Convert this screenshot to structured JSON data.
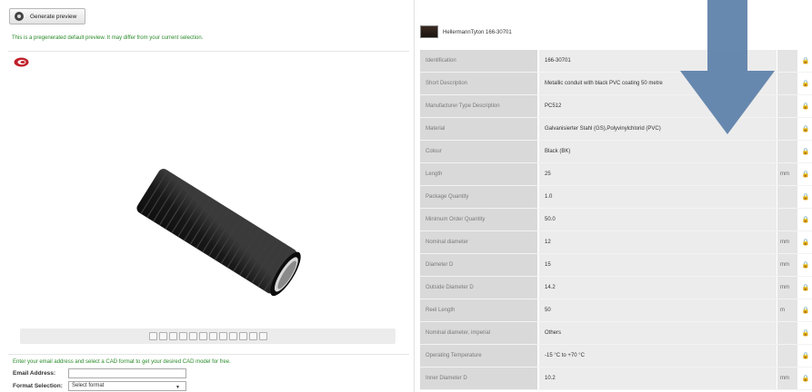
{
  "left": {
    "generate_button": "Generate preview",
    "note": "This is a pregenerated default preview. It may differ from your current selection.",
    "email_info": "Enter your email address and select a CAD format to get your desired CAD model for free.",
    "email_label": "Email Address:",
    "format_label": "Format Selection:",
    "format_value": "Select format"
  },
  "product": {
    "title": "HellermannTyton 166-30701"
  },
  "rows": [
    {
      "label": "Identification",
      "value": "166-30701",
      "unit": ""
    },
    {
      "label": "Short Description",
      "value": "Metallic conduit with black PVC coating 50 metre",
      "unit": ""
    },
    {
      "label": "Manufacturer Type Description",
      "value": "PC512",
      "unit": ""
    },
    {
      "label": "Material",
      "value": "Galvanisierter Stahl (GS),Polyvinylchlorid (PVC)",
      "unit": ""
    },
    {
      "label": "Colour",
      "value": "Black (BK)",
      "unit": ""
    },
    {
      "label": "Length",
      "value": "25",
      "unit": "mm"
    },
    {
      "label": "Package Quantity",
      "value": "1.0",
      "unit": ""
    },
    {
      "label": "Minimum Order Quantity",
      "value": "50.0",
      "unit": ""
    },
    {
      "label": "Nominal diameter",
      "value": "12",
      "unit": "mm"
    },
    {
      "label": "Diameter D",
      "value": "15",
      "unit": "mm"
    },
    {
      "label": "Outside Diameter D",
      "value": "14.2",
      "unit": "mm"
    },
    {
      "label": "Reel Length",
      "value": "50",
      "unit": "m"
    },
    {
      "label": "Nominal diameter, imperial",
      "value": "Others",
      "unit": ""
    },
    {
      "label": "Operating Temperature",
      "value": "-15 °C to +70 °C",
      "unit": ""
    },
    {
      "label": "Inner Diameter D",
      "value": "10.2",
      "unit": "mm"
    }
  ],
  "colors": {
    "note_green": "#2a8a2a",
    "label_bg": "#d9d9d9",
    "value_bg": "#ececec",
    "arrow_blue": "#5b7fa8"
  },
  "icons": [
    "refresh-icon",
    "brand-logo",
    "lock-icon",
    "down-arrow"
  ]
}
